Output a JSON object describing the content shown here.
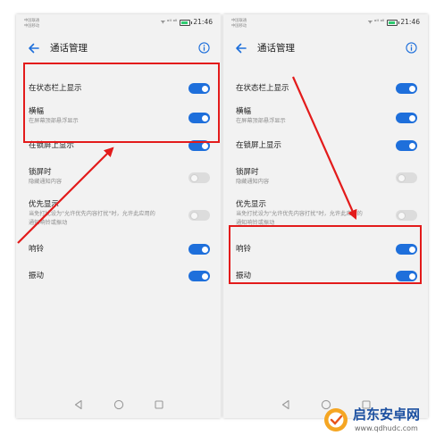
{
  "status_bar": {
    "carrier_1": "中国联通",
    "carrier_2": "中国移动",
    "signal_text": "ᯤ ᵒᴵᴵ ᵒᴵᴵ",
    "time": "21:46"
  },
  "header": {
    "title": "通话管理",
    "back_icon": "back-arrow-icon",
    "info_icon": "info-icon"
  },
  "settings": [
    {
      "title": "在状态栏上显示",
      "subtitle": "",
      "enabled": true
    },
    {
      "title": "横幅",
      "subtitle": "在屏幕顶部悬浮显示",
      "enabled": true
    },
    {
      "title": "在锁屏上显示",
      "subtitle": "",
      "enabled": true
    },
    {
      "title": "锁屏时",
      "subtitle": "隐藏通知内容",
      "enabled": false
    },
    {
      "title": "优先显示",
      "subtitle": "当免打扰设为\"允许优先内容打扰\"时，允许此应用的通知响铃或振动",
      "subtitle_line_1": "当免打扰设为\"允许优先内容打扰\"时，允许此应用的",
      "subtitle_line_2": "通知响铃或振动",
      "enabled": false
    },
    {
      "title": "响铃",
      "subtitle": "",
      "enabled": true
    },
    {
      "title": "振动",
      "subtitle": "",
      "enabled": true
    }
  ],
  "nav_bar": [
    "back-triangle-icon",
    "home-circle-icon",
    "recents-square-icon"
  ],
  "colors": {
    "accent": "#1e6fdb",
    "highlight": "#e31b1b",
    "background": "#f2f2f2"
  },
  "watermark": {
    "name": "启东安卓网",
    "url": "www.qdhudc.com"
  }
}
